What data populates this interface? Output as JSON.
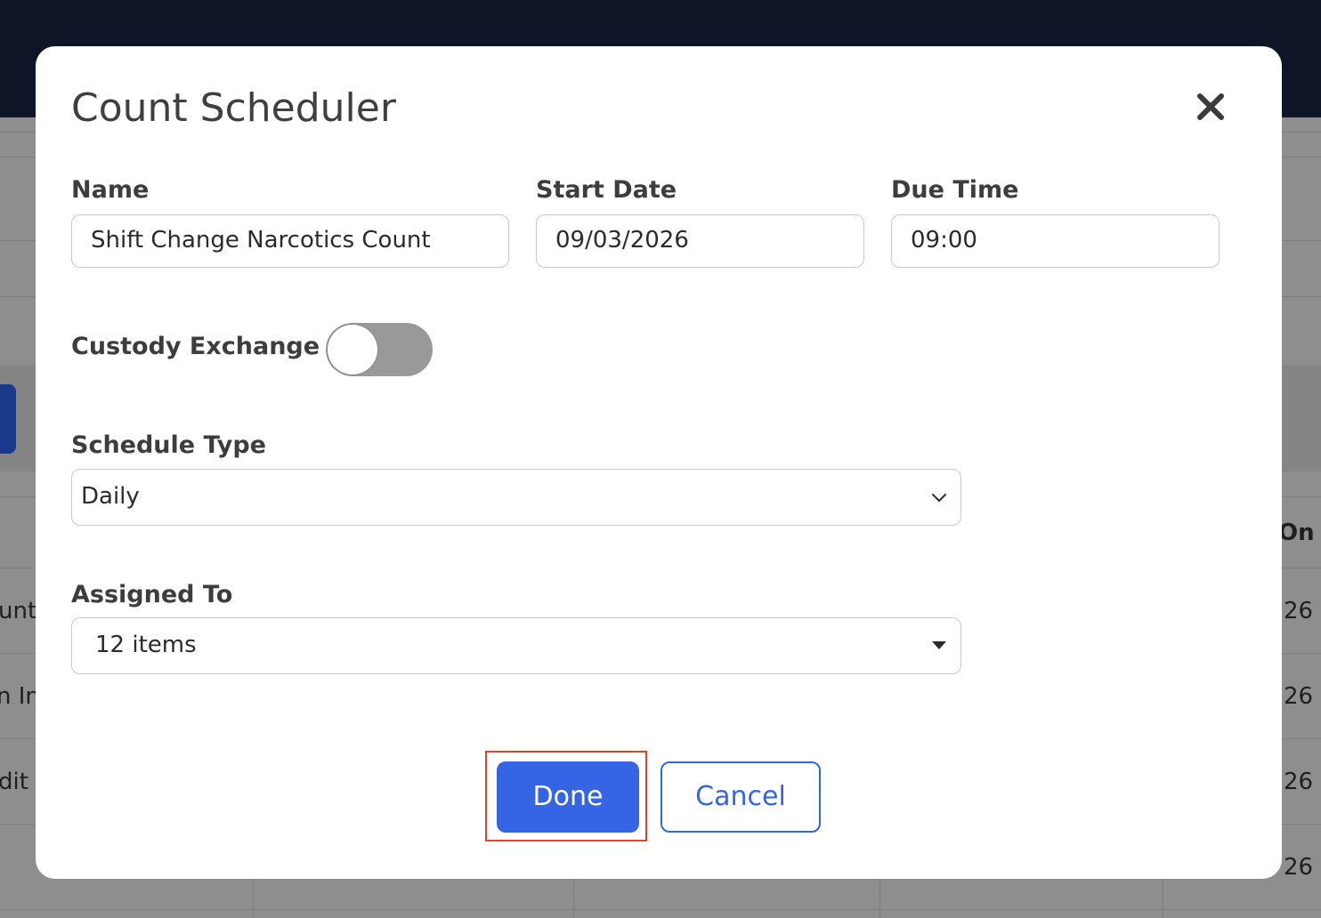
{
  "modal": {
    "title": "Count Scheduler",
    "close_icon": "close-icon",
    "fields": {
      "name": {
        "label": "Name",
        "value": "Shift Change Narcotics Count"
      },
      "start_date": {
        "label": "Start Date",
        "value": "09/03/2026"
      },
      "due_time": {
        "label": "Due Time",
        "value": "09:00"
      }
    },
    "custody_exchange": {
      "label": "Custody Exchange",
      "checked": false
    },
    "schedule_type": {
      "label": "Schedule Type",
      "value": "Daily",
      "icon": "chevron-down-icon"
    },
    "assigned_to": {
      "label": "Assigned To",
      "value": "12 items",
      "icon": "caret-down-icon"
    },
    "buttons": {
      "done": "Done",
      "cancel": "Cancel"
    }
  },
  "background": {
    "header_fragment": "On",
    "left_fragments": [
      "unt",
      "n In",
      "dit"
    ],
    "right_fragments": [
      "26",
      "26",
      "26",
      "26"
    ]
  },
  "colors": {
    "topbar": "#0d1526",
    "primary": "#3565e5",
    "focus_outline": "#e0452b",
    "toggle_off": "#999999"
  }
}
